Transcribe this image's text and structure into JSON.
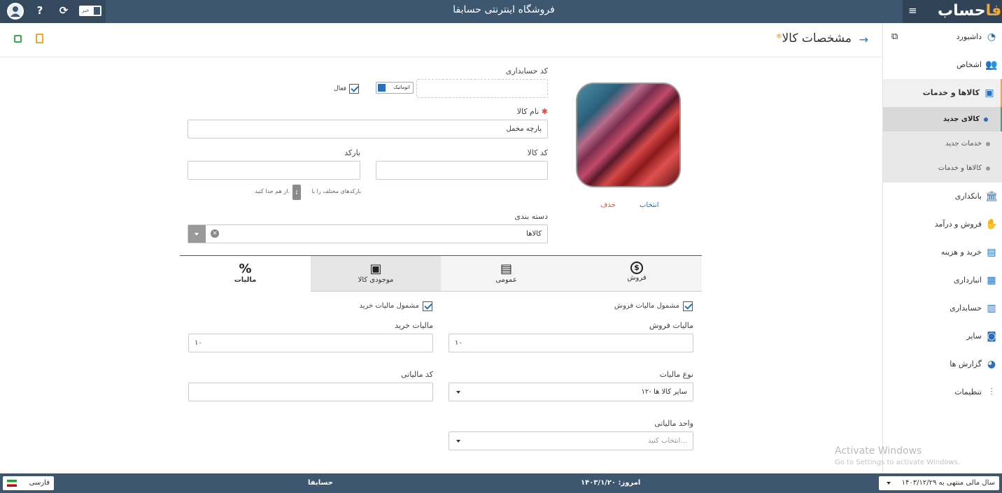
{
  "header": {
    "title": "فروشگاه اینترنتی حسابفا",
    "logo_text": "حساب",
    "logo_accent": "فا",
    "news_label": "خبر"
  },
  "sidebar": {
    "items": [
      {
        "label": "داشبورد",
        "icon": "speedometer-icon"
      },
      {
        "label": "اشخاص",
        "icon": "people-icon"
      },
      {
        "label": "کالاها و خدمات",
        "icon": "box-icon"
      },
      {
        "label": "بانکداری",
        "icon": "bank-icon"
      },
      {
        "label": "فروش و درآمد",
        "icon": "hand-coin-icon"
      },
      {
        "label": "خرید و هزینه",
        "icon": "wallet-icon"
      },
      {
        "label": "انبارداری",
        "icon": "warehouse-icon"
      },
      {
        "label": "حسابداری",
        "icon": "ledger-icon"
      },
      {
        "label": "سایر",
        "icon": "robot-icon"
      },
      {
        "label": "گزارش ها",
        "icon": "pie-chart-icon"
      },
      {
        "label": "تنظیمات",
        "icon": "sliders-icon"
      }
    ],
    "subitems": [
      {
        "label": "کالای جدید"
      },
      {
        "label": "خدمات جدید"
      },
      {
        "label": "کالاها و خدمات"
      }
    ]
  },
  "page": {
    "title": "مشخصات کالا",
    "star": "*"
  },
  "form": {
    "accounting_code_label": "کد حسابداری",
    "auto_label": "اتوماتیک",
    "active_label": "فعال",
    "name_label": "نام کالا",
    "name_value": "پارچه مخمل",
    "code_label": "کد کالا",
    "barcode_label": "بارکد",
    "barcode_hint_pre": "بارکدهای مختلف را با",
    "barcode_hint_sep": ";",
    "barcode_hint_post": "از هم جدا کنید.",
    "category_label": "دسته بندی",
    "category_value": "کالاها",
    "image_select": "انتخاب",
    "image_delete": "حذف"
  },
  "tabs": [
    {
      "label": "فروش",
      "icon": "dollar-circle-icon",
      "glyph": "$"
    },
    {
      "label": "عمومی",
      "icon": "message-icon",
      "glyph": "▤"
    },
    {
      "label": "موجودی کالا",
      "icon": "inventory-icon",
      "glyph": "▣"
    },
    {
      "label": "مالیات",
      "icon": "percent-icon",
      "glyph": "%"
    }
  ],
  "tax": {
    "sales_tax_check": "مشمول مالیات فروش",
    "purchase_tax_check": "مشمول مالیات خرید",
    "sales_tax_label": "مالیات فروش",
    "sales_tax_value": "۱۰",
    "purchase_tax_label": "مالیات خرید",
    "purchase_tax_value": "۱۰",
    "tax_type_label": "نوع مالیات",
    "tax_type_value": "۱۲- سایر کالا ها",
    "tax_code_label": "کد مالیاتی",
    "tax_unit_label": "واحد مالیاتی",
    "tax_unit_placeholder": "انتخاب کنید..."
  },
  "watermark": {
    "title": "Activate Windows",
    "subtitle": "Go to Settings to activate Windows."
  },
  "footer": {
    "fiscal_year": "سال مالی منتهی به ۱۴۰۳/۱۲/۲۹",
    "today": "امروز: ۱۴۰۳/۱/۲۰",
    "company": "حسابفا",
    "language": "فارسی"
  },
  "colors": {
    "header": "#3e5771",
    "accent": "#f0a830",
    "link": "#2a6fb8",
    "danger": "#e04a3a"
  }
}
